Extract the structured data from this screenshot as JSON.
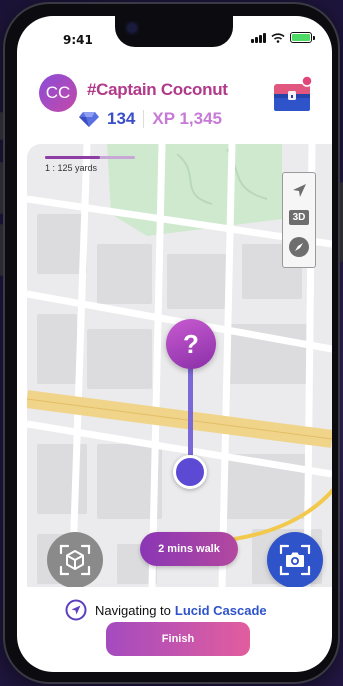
{
  "status": {
    "time": "9:41"
  },
  "profile": {
    "avatar_initials": "CC",
    "username": "#Captain Coconut",
    "gems": "134",
    "xp": "XP 1,345"
  },
  "map": {
    "scale_label": "1 : 125 yards",
    "controls": {
      "three_d_label": "3D"
    },
    "marker": {
      "symbol": "?"
    },
    "walk_time": "2 mins walk"
  },
  "navigation": {
    "prefix": "Navigating to",
    "destination": "Lucid Cascade",
    "finish_label": "Finish"
  },
  "colors": {
    "accent_purple": "#b13a8a",
    "accent_blue": "#2f53c9",
    "map_park": "#cfe9cf",
    "map_highway": "#f0d48a",
    "route_line": "#f2c94c"
  },
  "icons": [
    "gem-icon",
    "treasure-chest-icon",
    "location-arrow-icon",
    "compass-icon",
    "ar-cube-icon",
    "camera-icon",
    "navigation-icon"
  ]
}
